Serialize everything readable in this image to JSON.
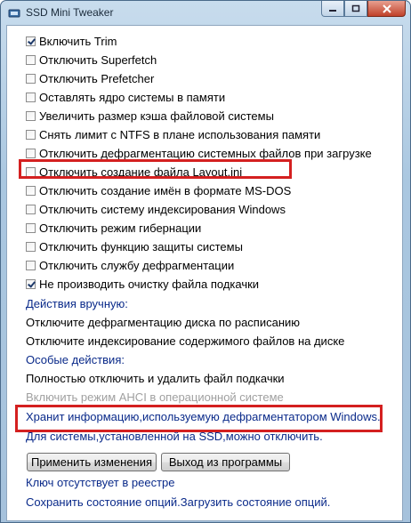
{
  "window": {
    "title": "SSD Mini Tweaker",
    "icon": "app-icon"
  },
  "options": [
    {
      "label": "Включить Trim",
      "checked": true
    },
    {
      "label": "Отключить Superfetch",
      "checked": false
    },
    {
      "label": "Отключить Prefetcher",
      "checked": false
    },
    {
      "label": "Оставлять ядро системы в памяти",
      "checked": false
    },
    {
      "label": "Увеличить размер кэша файловой системы",
      "checked": false
    },
    {
      "label": "Снять лимит с NTFS в плане использования памяти",
      "checked": false
    },
    {
      "label": "Отключить дефрагментацию системных файлов при загрузке",
      "checked": false
    },
    {
      "label": "Отключить создание файла Layout.ini",
      "checked": false
    },
    {
      "label": "Отключить создание имён в формате MS-DOS",
      "checked": false
    },
    {
      "label": "Отключить систему индексирования Windows",
      "checked": false
    },
    {
      "label": "Отключить режим гибернации",
      "checked": false
    },
    {
      "label": "Отключить функцию защиты системы",
      "checked": false
    },
    {
      "label": "Отключить службу дефрагментации",
      "checked": false
    },
    {
      "label": "Не производить очистку файла подкачки",
      "checked": true
    }
  ],
  "manual": {
    "header": "Действия вручную:",
    "items": [
      "Отключите дефрагментацию диска по расписанию",
      "Отключите индексирование содержимого файлов на диске"
    ]
  },
  "special": {
    "header": "Особые действия:",
    "items": [
      "Полностью отключить и удалить файл подкачки",
      "Включить режим AHCI в операционной системе"
    ]
  },
  "info": {
    "line1": "Хранит информацию,используемую дефрагментатором Windows.",
    "line2": "Для системы,установленной на SSD,можно отключить."
  },
  "buttons": {
    "apply": "Применить изменения",
    "exit": "Выход из программы"
  },
  "status": {
    "registry": "Ключ отсутствует в реестре",
    "save_load": "Сохранить состояние опций.Загрузить состояние опций."
  },
  "colors": {
    "highlight": "#d42020",
    "section_text": "#0a2a8a"
  }
}
